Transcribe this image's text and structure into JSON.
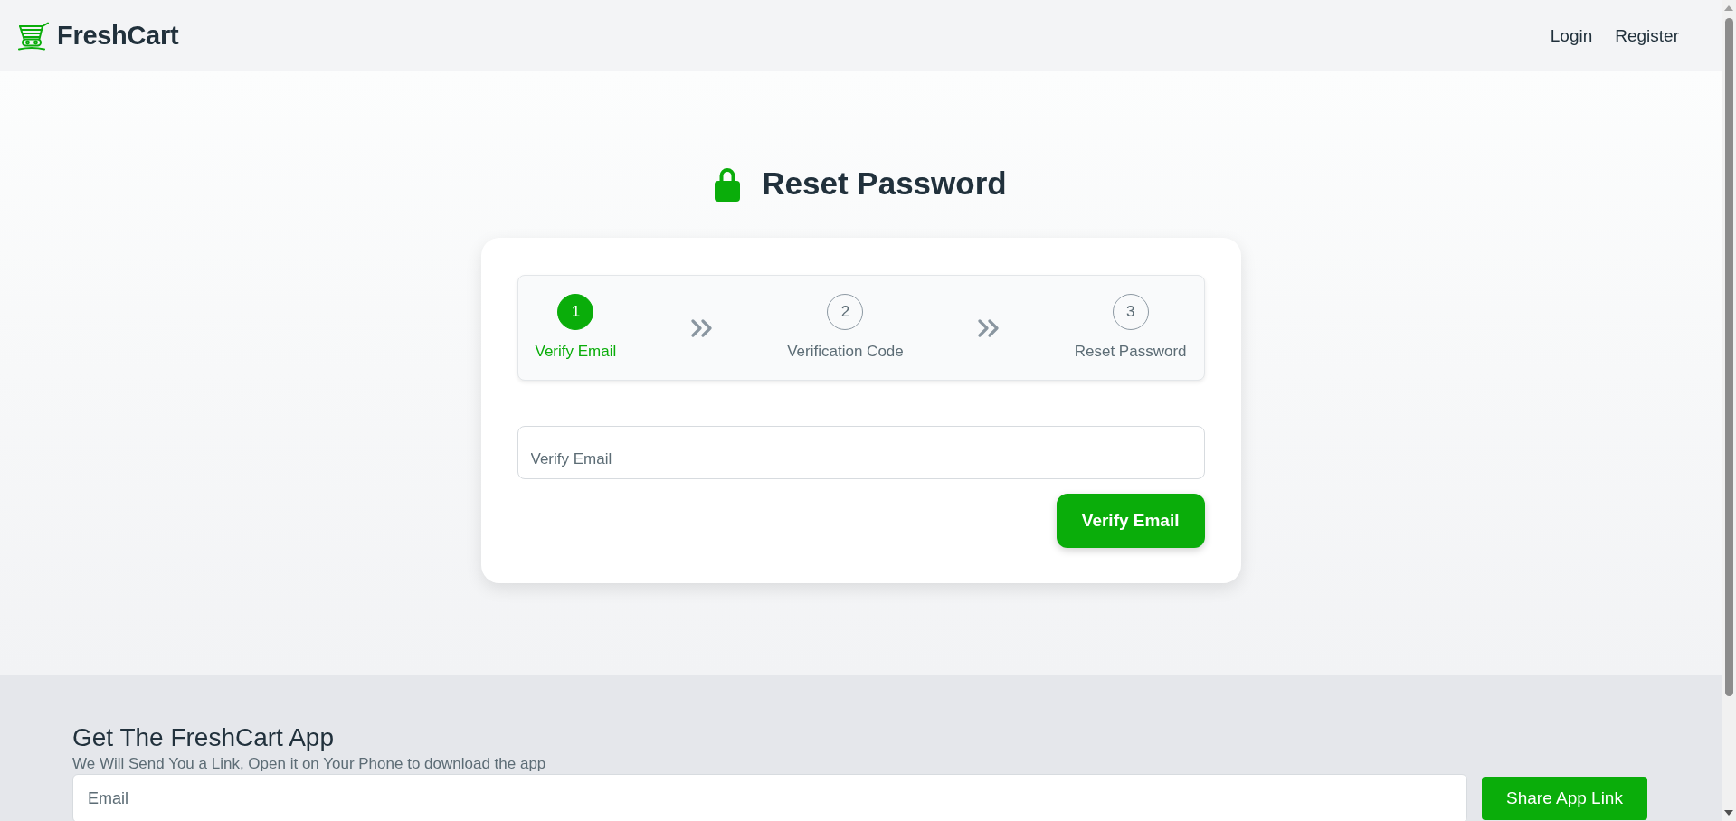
{
  "header": {
    "brand": "FreshCart",
    "nav": [
      {
        "label": "Login"
      },
      {
        "label": "Register"
      }
    ]
  },
  "page_title": "Reset Password",
  "stepper": {
    "steps": [
      {
        "number": "1",
        "label": "Verify Email",
        "selected": true
      },
      {
        "number": "2",
        "label": "Verification Code",
        "selected": false
      },
      {
        "number": "3",
        "label": "Reset Password",
        "selected": false
      }
    ]
  },
  "form": {
    "email_field": {
      "placeholder": "Verify Email"
    },
    "submit_button": "Verify Email"
  },
  "footer": {
    "title": "Get The FreshCart App",
    "subtitle": "We Will Send You a Link, Open it on Your Phone to download the app",
    "email_field": {
      "placeholder": "Email"
    },
    "share_button": "Share App Link"
  }
}
